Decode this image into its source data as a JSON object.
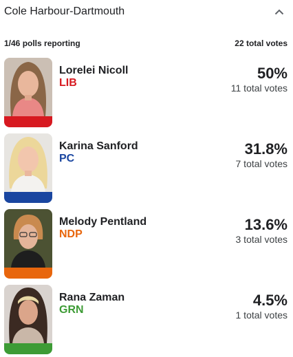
{
  "race": {
    "district": "Cole Harbour-Dartmouth",
    "polls_reporting": "1/46 polls reporting",
    "total_votes": "22 total votes"
  },
  "candidates": [
    {
      "name": "Lorelei Nicoll",
      "party": "LIB",
      "party_color": "#d71920",
      "percent": "50%",
      "percent_value": 50,
      "votes": "11 total votes",
      "vote_count": 11
    },
    {
      "name": "Karina Sanford",
      "party": "PC",
      "party_color": "#1a46a0",
      "percent": "31.8%",
      "percent_value": 31.8,
      "votes": "7 total votes",
      "vote_count": 7
    },
    {
      "name": "Melody Pentland",
      "party": "NDP",
      "party_color": "#e8660d",
      "percent": "13.6%",
      "percent_value": 13.6,
      "votes": "3 total votes",
      "vote_count": 3
    },
    {
      "name": "Rana Zaman",
      "party": "GRN",
      "party_color": "#3d9b35",
      "percent": "4.5%",
      "percent_value": 4.5,
      "votes": "1 total votes",
      "vote_count": 1
    }
  ],
  "icons": {
    "collapse": "chevron-up-icon"
  }
}
